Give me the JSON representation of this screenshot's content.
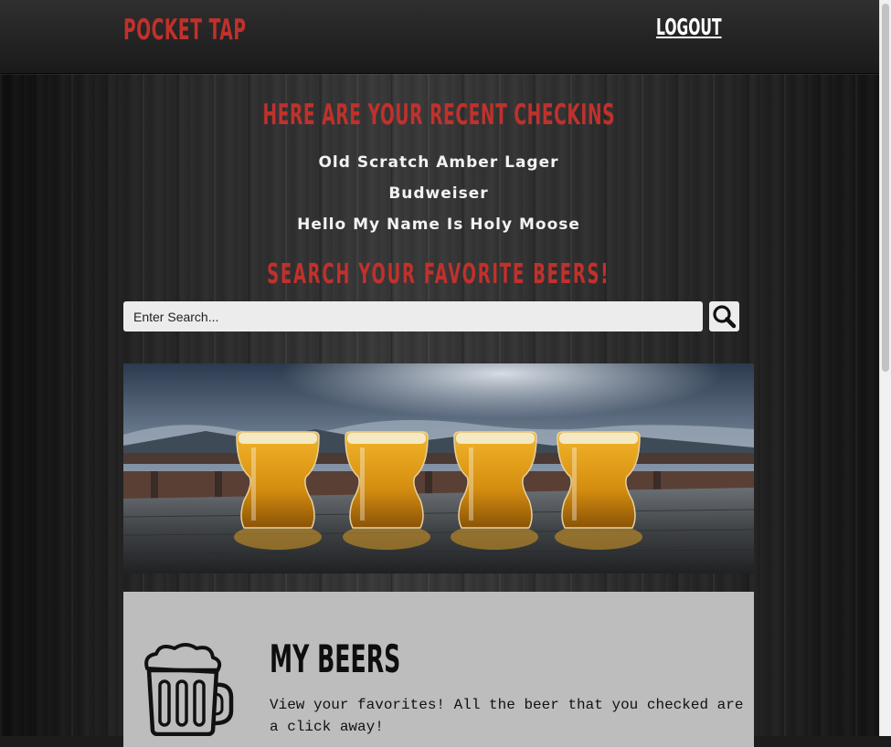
{
  "nav": {
    "brand": "POCKET TAP",
    "logout": "LOGOUT"
  },
  "checkins": {
    "heading": "HERE ARE YOUR RECENT CHECKINS",
    "items": [
      "Old Scratch Amber Lager",
      "Budweiser",
      "Hello My Name Is Holy Moose"
    ]
  },
  "search": {
    "heading": "SEARCH YOUR FAVORITE BEERS!",
    "placeholder": "Enter Search...",
    "button_icon": "search-icon"
  },
  "hero": {
    "icon": "beer-glasses-photo"
  },
  "card": {
    "icon": "beer-mug-icon",
    "title": "MY BEERS",
    "description": "View your favorites! All the beer that you checked are a click away!"
  },
  "colors": {
    "accent": "#c0312c",
    "nav_background": "#222222",
    "card_background": "#bdbdbd",
    "input_background": "#ececec"
  }
}
